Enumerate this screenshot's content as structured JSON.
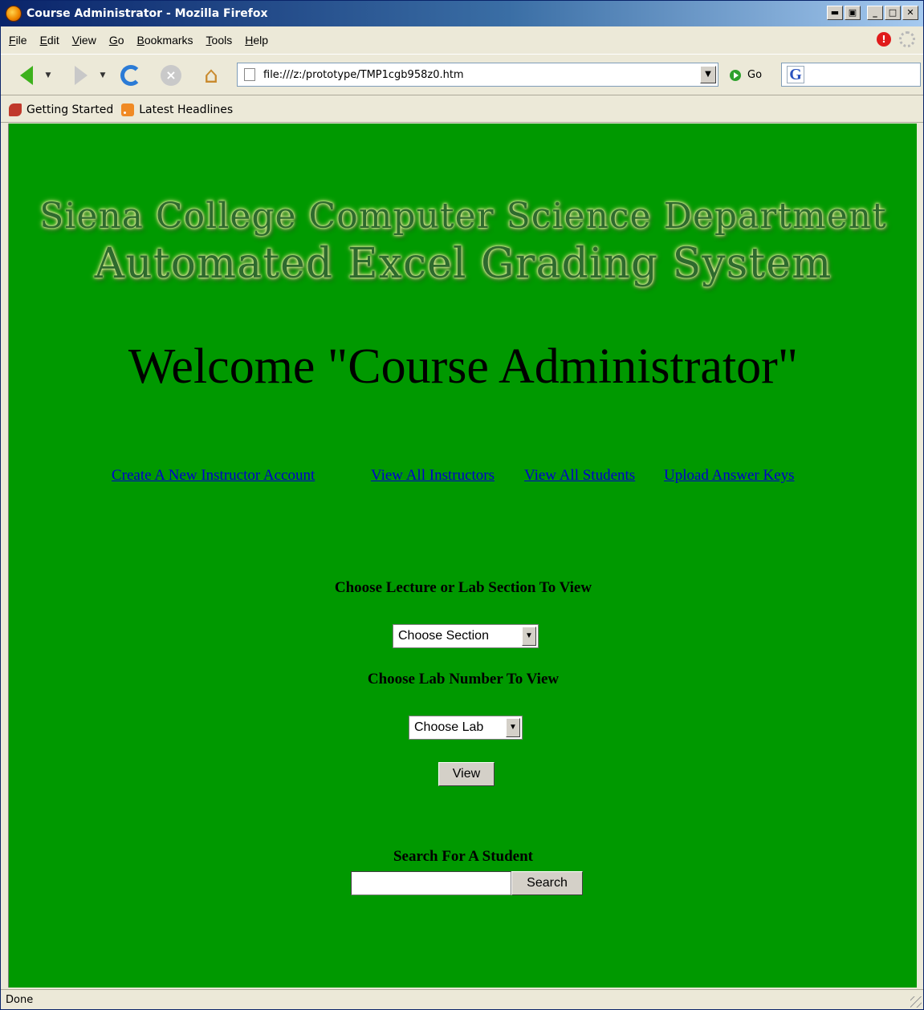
{
  "window": {
    "title": "Course Administrator - Mozilla Firefox"
  },
  "menu": [
    {
      "key": "F",
      "rest": "ile"
    },
    {
      "key": "E",
      "rest": "dit"
    },
    {
      "key": "V",
      "rest": "iew"
    },
    {
      "key": "G",
      "rest": "o"
    },
    {
      "key": "B",
      "rest": "ookmarks"
    },
    {
      "key": "T",
      "rest": "ools"
    },
    {
      "key": "H",
      "rest": "elp"
    }
  ],
  "navbar": {
    "url": "file:///z:/prototype/TMP1cgb958z0.htm",
    "go_label": "Go"
  },
  "bookmarks": [
    {
      "label": "Getting Started",
      "icon": "firefox-bookmark-icon"
    },
    {
      "label": "Latest Headlines",
      "icon": "rss-feed-icon"
    }
  ],
  "page": {
    "banner_line1": "Siena College Computer Science Department",
    "banner_line2": "Automated Excel Grading System",
    "welcome": "Welcome \"Course Administrator\"",
    "links": {
      "create": "Create A New Instructor Account",
      "instructors": "View All Instructors",
      "students": "View All Students",
      "upload": "Upload Answer Keys"
    },
    "section_label": "Choose Lecture or Lab Section To View",
    "section_select": "Choose Section",
    "lab_label": "Choose Lab Number To View",
    "lab_select": "Choose Lab",
    "view_button": "View",
    "search_label": "Search For A Student",
    "search_value": "",
    "search_button": "Search"
  },
  "status": {
    "text": "Done"
  },
  "colors": {
    "page_background": "#009900",
    "link": "#0000cc",
    "titlebar": "#0a246a"
  }
}
